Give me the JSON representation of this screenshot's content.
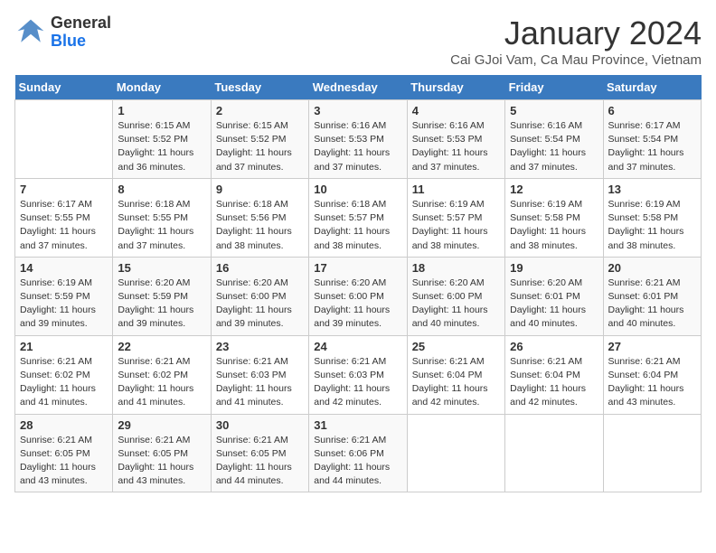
{
  "header": {
    "logo_line1": "General",
    "logo_line2": "Blue",
    "month_title": "January 2024",
    "location": "Cai GJoi Vam, Ca Mau Province, Vietnam"
  },
  "days_of_week": [
    "Sunday",
    "Monday",
    "Tuesday",
    "Wednesday",
    "Thursday",
    "Friday",
    "Saturday"
  ],
  "weeks": [
    [
      {
        "day": "",
        "info": ""
      },
      {
        "day": "1",
        "info": "Sunrise: 6:15 AM\nSunset: 5:52 PM\nDaylight: 11 hours\nand 36 minutes."
      },
      {
        "day": "2",
        "info": "Sunrise: 6:15 AM\nSunset: 5:52 PM\nDaylight: 11 hours\nand 37 minutes."
      },
      {
        "day": "3",
        "info": "Sunrise: 6:16 AM\nSunset: 5:53 PM\nDaylight: 11 hours\nand 37 minutes."
      },
      {
        "day": "4",
        "info": "Sunrise: 6:16 AM\nSunset: 5:53 PM\nDaylight: 11 hours\nand 37 minutes."
      },
      {
        "day": "5",
        "info": "Sunrise: 6:16 AM\nSunset: 5:54 PM\nDaylight: 11 hours\nand 37 minutes."
      },
      {
        "day": "6",
        "info": "Sunrise: 6:17 AM\nSunset: 5:54 PM\nDaylight: 11 hours\nand 37 minutes."
      }
    ],
    [
      {
        "day": "7",
        "info": "Sunrise: 6:17 AM\nSunset: 5:55 PM\nDaylight: 11 hours\nand 37 minutes."
      },
      {
        "day": "8",
        "info": "Sunrise: 6:18 AM\nSunset: 5:55 PM\nDaylight: 11 hours\nand 37 minutes."
      },
      {
        "day": "9",
        "info": "Sunrise: 6:18 AM\nSunset: 5:56 PM\nDaylight: 11 hours\nand 38 minutes."
      },
      {
        "day": "10",
        "info": "Sunrise: 6:18 AM\nSunset: 5:57 PM\nDaylight: 11 hours\nand 38 minutes."
      },
      {
        "day": "11",
        "info": "Sunrise: 6:19 AM\nSunset: 5:57 PM\nDaylight: 11 hours\nand 38 minutes."
      },
      {
        "day": "12",
        "info": "Sunrise: 6:19 AM\nSunset: 5:58 PM\nDaylight: 11 hours\nand 38 minutes."
      },
      {
        "day": "13",
        "info": "Sunrise: 6:19 AM\nSunset: 5:58 PM\nDaylight: 11 hours\nand 38 minutes."
      }
    ],
    [
      {
        "day": "14",
        "info": "Sunrise: 6:19 AM\nSunset: 5:59 PM\nDaylight: 11 hours\nand 39 minutes."
      },
      {
        "day": "15",
        "info": "Sunrise: 6:20 AM\nSunset: 5:59 PM\nDaylight: 11 hours\nand 39 minutes."
      },
      {
        "day": "16",
        "info": "Sunrise: 6:20 AM\nSunset: 6:00 PM\nDaylight: 11 hours\nand 39 minutes."
      },
      {
        "day": "17",
        "info": "Sunrise: 6:20 AM\nSunset: 6:00 PM\nDaylight: 11 hours\nand 39 minutes."
      },
      {
        "day": "18",
        "info": "Sunrise: 6:20 AM\nSunset: 6:00 PM\nDaylight: 11 hours\nand 40 minutes."
      },
      {
        "day": "19",
        "info": "Sunrise: 6:20 AM\nSunset: 6:01 PM\nDaylight: 11 hours\nand 40 minutes."
      },
      {
        "day": "20",
        "info": "Sunrise: 6:21 AM\nSunset: 6:01 PM\nDaylight: 11 hours\nand 40 minutes."
      }
    ],
    [
      {
        "day": "21",
        "info": "Sunrise: 6:21 AM\nSunset: 6:02 PM\nDaylight: 11 hours\nand 41 minutes."
      },
      {
        "day": "22",
        "info": "Sunrise: 6:21 AM\nSunset: 6:02 PM\nDaylight: 11 hours\nand 41 minutes."
      },
      {
        "day": "23",
        "info": "Sunrise: 6:21 AM\nSunset: 6:03 PM\nDaylight: 11 hours\nand 41 minutes."
      },
      {
        "day": "24",
        "info": "Sunrise: 6:21 AM\nSunset: 6:03 PM\nDaylight: 11 hours\nand 42 minutes."
      },
      {
        "day": "25",
        "info": "Sunrise: 6:21 AM\nSunset: 6:04 PM\nDaylight: 11 hours\nand 42 minutes."
      },
      {
        "day": "26",
        "info": "Sunrise: 6:21 AM\nSunset: 6:04 PM\nDaylight: 11 hours\nand 42 minutes."
      },
      {
        "day": "27",
        "info": "Sunrise: 6:21 AM\nSunset: 6:04 PM\nDaylight: 11 hours\nand 43 minutes."
      }
    ],
    [
      {
        "day": "28",
        "info": "Sunrise: 6:21 AM\nSunset: 6:05 PM\nDaylight: 11 hours\nand 43 minutes."
      },
      {
        "day": "29",
        "info": "Sunrise: 6:21 AM\nSunset: 6:05 PM\nDaylight: 11 hours\nand 43 minutes."
      },
      {
        "day": "30",
        "info": "Sunrise: 6:21 AM\nSunset: 6:05 PM\nDaylight: 11 hours\nand 44 minutes."
      },
      {
        "day": "31",
        "info": "Sunrise: 6:21 AM\nSunset: 6:06 PM\nDaylight: 11 hours\nand 44 minutes."
      },
      {
        "day": "",
        "info": ""
      },
      {
        "day": "",
        "info": ""
      },
      {
        "day": "",
        "info": ""
      }
    ]
  ]
}
